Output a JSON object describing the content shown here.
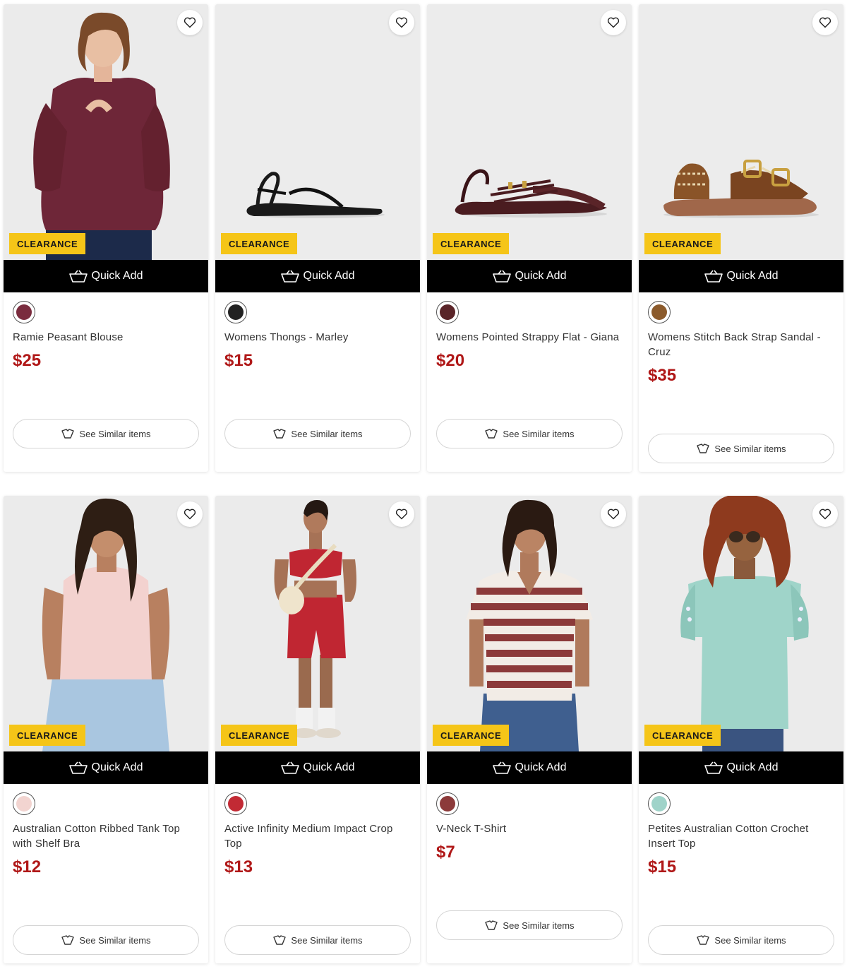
{
  "colors": {
    "badge": "#f5c518",
    "price": "#b01818",
    "quick_add_bg": "#000000"
  },
  "products": [
    {
      "name": "Ramie Peasant Blouse",
      "price": "$25",
      "badge": "CLEARANCE",
      "quick_add": "Quick Add",
      "similar": "See Similar items",
      "swatch": "#7a2c3e",
      "image": "model-plum-blouse"
    },
    {
      "name": "Womens Thongs - Marley",
      "price": "$15",
      "badge": "CLEARANCE",
      "quick_add": "Quick Add",
      "similar": "See Similar items",
      "swatch": "#222222",
      "image": "black-thong-sandal"
    },
    {
      "name": "Womens Pointed Strappy Flat - Giana",
      "price": "$20",
      "badge": "CLEARANCE",
      "quick_add": "Quick Add",
      "similar": "See Similar items",
      "swatch": "#5a2428",
      "image": "burgundy-strappy-flat"
    },
    {
      "name": "Womens Stitch Back Strap Sandal - Cruz",
      "price": "$35",
      "badge": "CLEARANCE",
      "quick_add": "Quick Add",
      "similar": "See Similar items",
      "swatch": "#8b5a2b",
      "image": "tan-buckle-sandal"
    },
    {
      "name": "Australian Cotton Ribbed Tank Top with Shelf Bra",
      "price": "$12",
      "badge": "CLEARANCE",
      "quick_add": "Quick Add",
      "similar": "See Similar items",
      "swatch": "#f2d4d0",
      "image": "model-pink-tank"
    },
    {
      "name": "Active Infinity Medium Impact Crop Top",
      "price": "$13",
      "badge": "CLEARANCE",
      "quick_add": "Quick Add",
      "similar": "See Similar items",
      "swatch": "#c22a34",
      "image": "model-red-activewear"
    },
    {
      "name": "V-Neck T-Shirt",
      "price": "$7",
      "badge": "CLEARANCE",
      "quick_add": "Quick Add",
      "similar": "See Similar items",
      "swatch": "#8c3a3a",
      "image": "model-striped-tee"
    },
    {
      "name": "Petites Australian Cotton Crochet Insert Top",
      "price": "$15",
      "badge": "CLEARANCE",
      "quick_add": "Quick Add",
      "similar": "See Similar items",
      "swatch": "#9fd3c9",
      "image": "model-mint-top"
    }
  ]
}
